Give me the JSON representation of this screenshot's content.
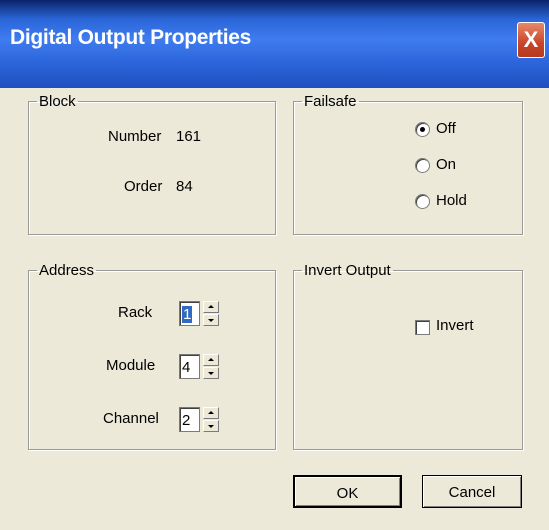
{
  "window": {
    "title": "Digital Output Properties",
    "close_glyph": "X"
  },
  "block": {
    "legend": "Block",
    "number_label": "Number",
    "number_value": "161",
    "order_label": "Order",
    "order_value": "84"
  },
  "failsafe": {
    "legend": "Failsafe",
    "options": [
      "Off",
      "On",
      "Hold"
    ],
    "selected": "Off"
  },
  "address": {
    "legend": "Address",
    "fields": [
      {
        "label": "Rack",
        "value": "1"
      },
      {
        "label": "Module",
        "value": "4"
      },
      {
        "label": "Channel",
        "value": "2"
      }
    ]
  },
  "invert_output": {
    "legend": "Invert Output",
    "checkbox_label": "Invert",
    "checked": false
  },
  "buttons": {
    "ok": "OK",
    "cancel": "Cancel"
  },
  "colors": {
    "title_bar": "#2a66d8",
    "dialog_bg": "#ece9d8",
    "close_button": "#c9452a",
    "selection": "#316ac5"
  }
}
